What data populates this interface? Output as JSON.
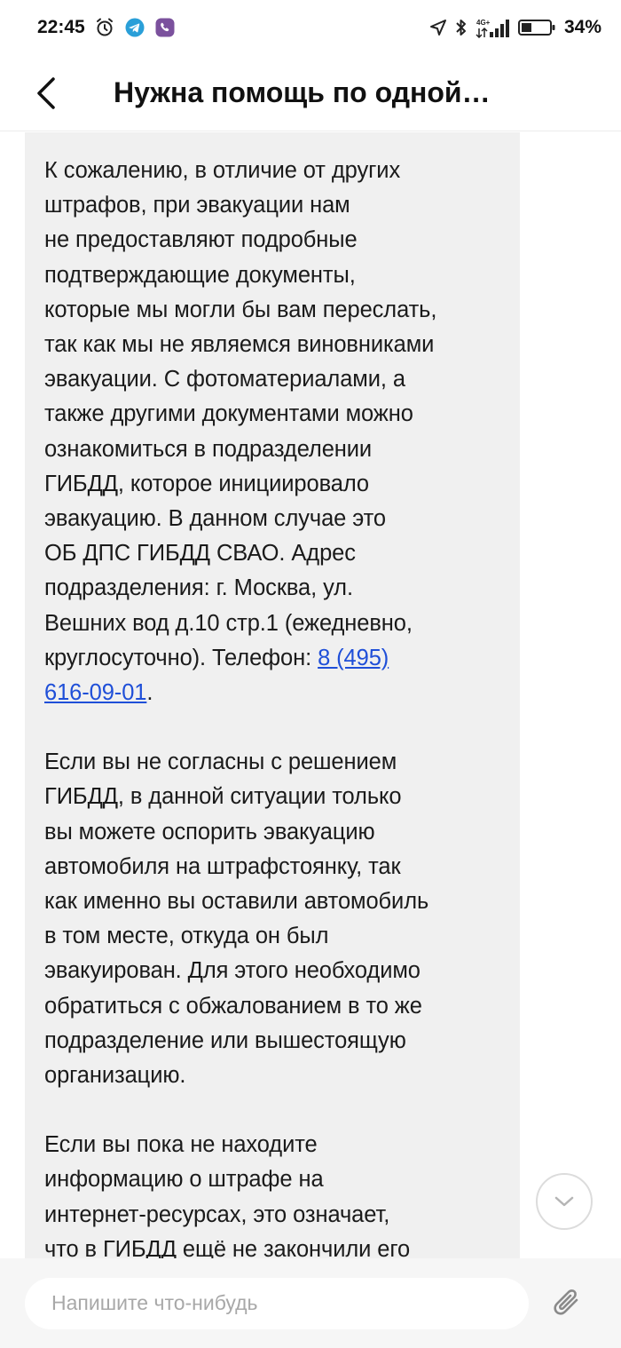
{
  "status_bar": {
    "time": "22:45",
    "network": "4G+",
    "battery": "34%"
  },
  "header": {
    "title": "Нужна помощь по одной…"
  },
  "message": {
    "p1_lines": [
      "К сожалению, в отличие от других",
      "штрафов, при эвакуации нам",
      "не предоставляют подробные",
      "подтверждающие документы,",
      "которые мы могли бы вам переслать,",
      "так как мы не являемся виновниками",
      "эвакуации. С фотоматериалами, а",
      "также другими документами можно",
      "ознакомиться в подразделении",
      "ГИБДД, которое инициировало",
      "эвакуацию. В данном случае это",
      "ОБ ДПС ГИБДД СВАО. Адрес",
      "подразделения: г. Москва, ул.",
      "Вешних вод д.10 стр.1 (ежедневно,",
      "круглосуточно). Телефон: "
    ],
    "phone_part1": "8 (495)",
    "phone_part2": "616-09-01",
    "phone_suffix": ".",
    "p2_lines": [
      "Если вы не согласны с решением",
      "ГИБДД, в данной ситуации только",
      "вы можете оспорить эвакуацию",
      "автомобиля на штрафстоянку, так",
      "как именно вы оставили автомобиль",
      "в том месте, откуда он был",
      "эвакуирован. Для этого необходимо",
      "обратиться с обжалованием в то же",
      "подразделение или вышестоящую",
      "организацию."
    ],
    "p3_lines": [
      "Если вы пока не находите",
      "информацию о штрафе на",
      "интернет-ресурсах, это означает,",
      "что в ГИБДД ещё не закончили его"
    ]
  },
  "input": {
    "placeholder": "Напишите что-нибудь"
  },
  "colors": {
    "bubble_bg": "#f0f0f0",
    "link": "#1f4fd8",
    "input_bar_bg": "#f6f6f6"
  }
}
